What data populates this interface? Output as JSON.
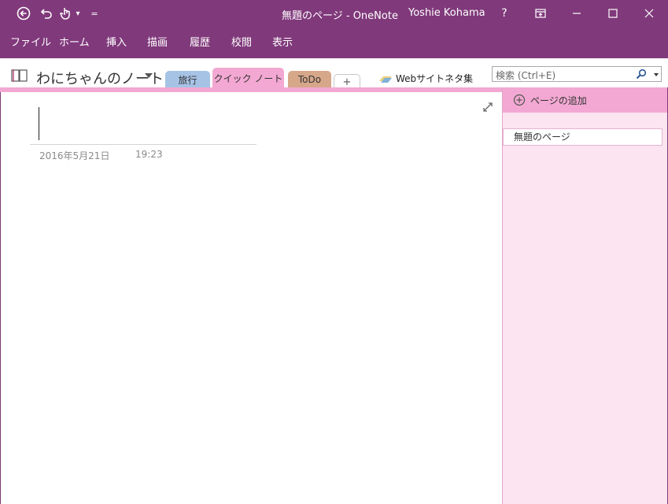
{
  "window": {
    "title": "無題のページ - OneNote",
    "user": "Yoshie Kohama",
    "help_label": "?",
    "colors": {
      "brand": "#80397b",
      "section_active": "#f2a8d2",
      "pane_bg": "#fce4f1"
    }
  },
  "quick_access": {
    "back_icon": "back-arrow-icon",
    "undo_icon": "undo-icon",
    "touch_icon": "touch-mode-icon",
    "dropdown_glyph": "▾",
    "customize_glyph": "="
  },
  "ribbon": {
    "tabs": [
      "ファイル",
      "ホーム",
      "挿入",
      "描画",
      "履歴",
      "校閲",
      "表示"
    ]
  },
  "notebook": {
    "name": "わにちゃんのノート"
  },
  "sections": [
    {
      "label": "旅行",
      "color": "#a6c3e6"
    },
    {
      "label": "クイック ノート",
      "color": "#f2a8d2"
    },
    {
      "label": "ToDo",
      "color": "#d7a78a"
    },
    {
      "label": "+",
      "color": "#ffffff"
    }
  ],
  "web_link": {
    "label": "Webサイトネタ集"
  },
  "search": {
    "placeholder": "検索 (Ctrl+E)"
  },
  "page": {
    "date": "2016年5月21日",
    "time": "19:23"
  },
  "pages_pane": {
    "add_page_label": "ページの追加",
    "items": [
      "無題のページ"
    ]
  }
}
